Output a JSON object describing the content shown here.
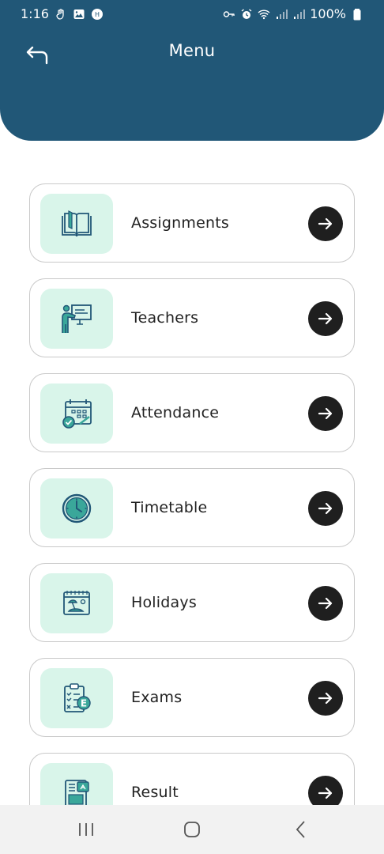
{
  "status_bar": {
    "time": "1:16",
    "battery": "100%"
  },
  "header": {
    "title": "Menu",
    "background_color": "#215777"
  },
  "menu": {
    "items": [
      {
        "label": "Assignments",
        "icon": "open-book-icon"
      },
      {
        "label": "Teachers",
        "icon": "teacher-board-icon"
      },
      {
        "label": "Attendance",
        "icon": "calendar-check-icon"
      },
      {
        "label": "Timetable",
        "icon": "clock-icon"
      },
      {
        "label": "Holidays",
        "icon": "beach-calendar-icon"
      },
      {
        "label": "Exams",
        "icon": "exam-clipboard-icon"
      },
      {
        "label": "Result",
        "icon": "result-report-icon"
      }
    ],
    "icon_box_color": "#d9f5ea",
    "icon_color": "#215777",
    "arrow_button_color": "#1f1f1f"
  },
  "nav_bar": {
    "buttons": [
      "recent-apps",
      "home",
      "back"
    ]
  }
}
